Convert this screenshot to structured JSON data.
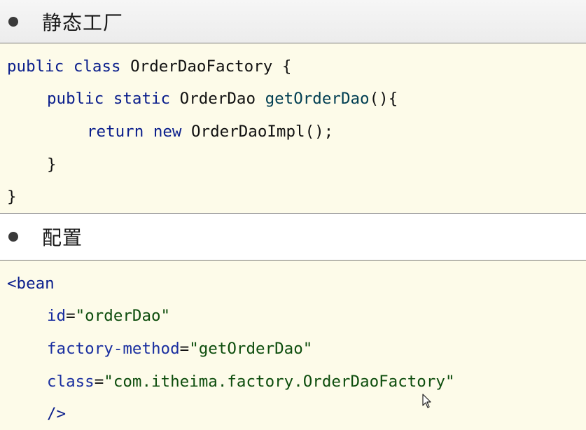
{
  "sections": [
    {
      "title": "静态工厂"
    },
    {
      "title": "配置"
    }
  ],
  "code1": {
    "l1": {
      "kw1": "public",
      "kw2": "class",
      "name": "OrderDaoFactory",
      "brace": "{"
    },
    "l2": {
      "kw1": "public",
      "kw2": "static",
      "type": "OrderDao",
      "method": "getOrderDao",
      "tail": "(){"
    },
    "l3": {
      "kw1": "return",
      "kw2": "new",
      "call": "OrderDaoImpl();"
    },
    "l4": {
      "text": "}"
    },
    "l5": {
      "text": "}"
    }
  },
  "code2": {
    "l1": {
      "open": "<bean"
    },
    "l2": {
      "attr": "id",
      "eq": "=",
      "val": "\"orderDao\""
    },
    "l3": {
      "attr": "factory-method",
      "eq": "=",
      "val": "\"getOrderDao\""
    },
    "l4": {
      "attr": "class",
      "eq": "=",
      "val": "\"com.itheima.factory.OrderDaoFactory\""
    },
    "l5": {
      "close": "/>"
    }
  },
  "colors": {
    "code_background": "#fdfbe9",
    "keyword": "#0a1e8c",
    "string": "#0d4d0d"
  },
  "icons": {
    "bullet": "filled-circle",
    "cursor": "mouse-pointer-arrow"
  }
}
